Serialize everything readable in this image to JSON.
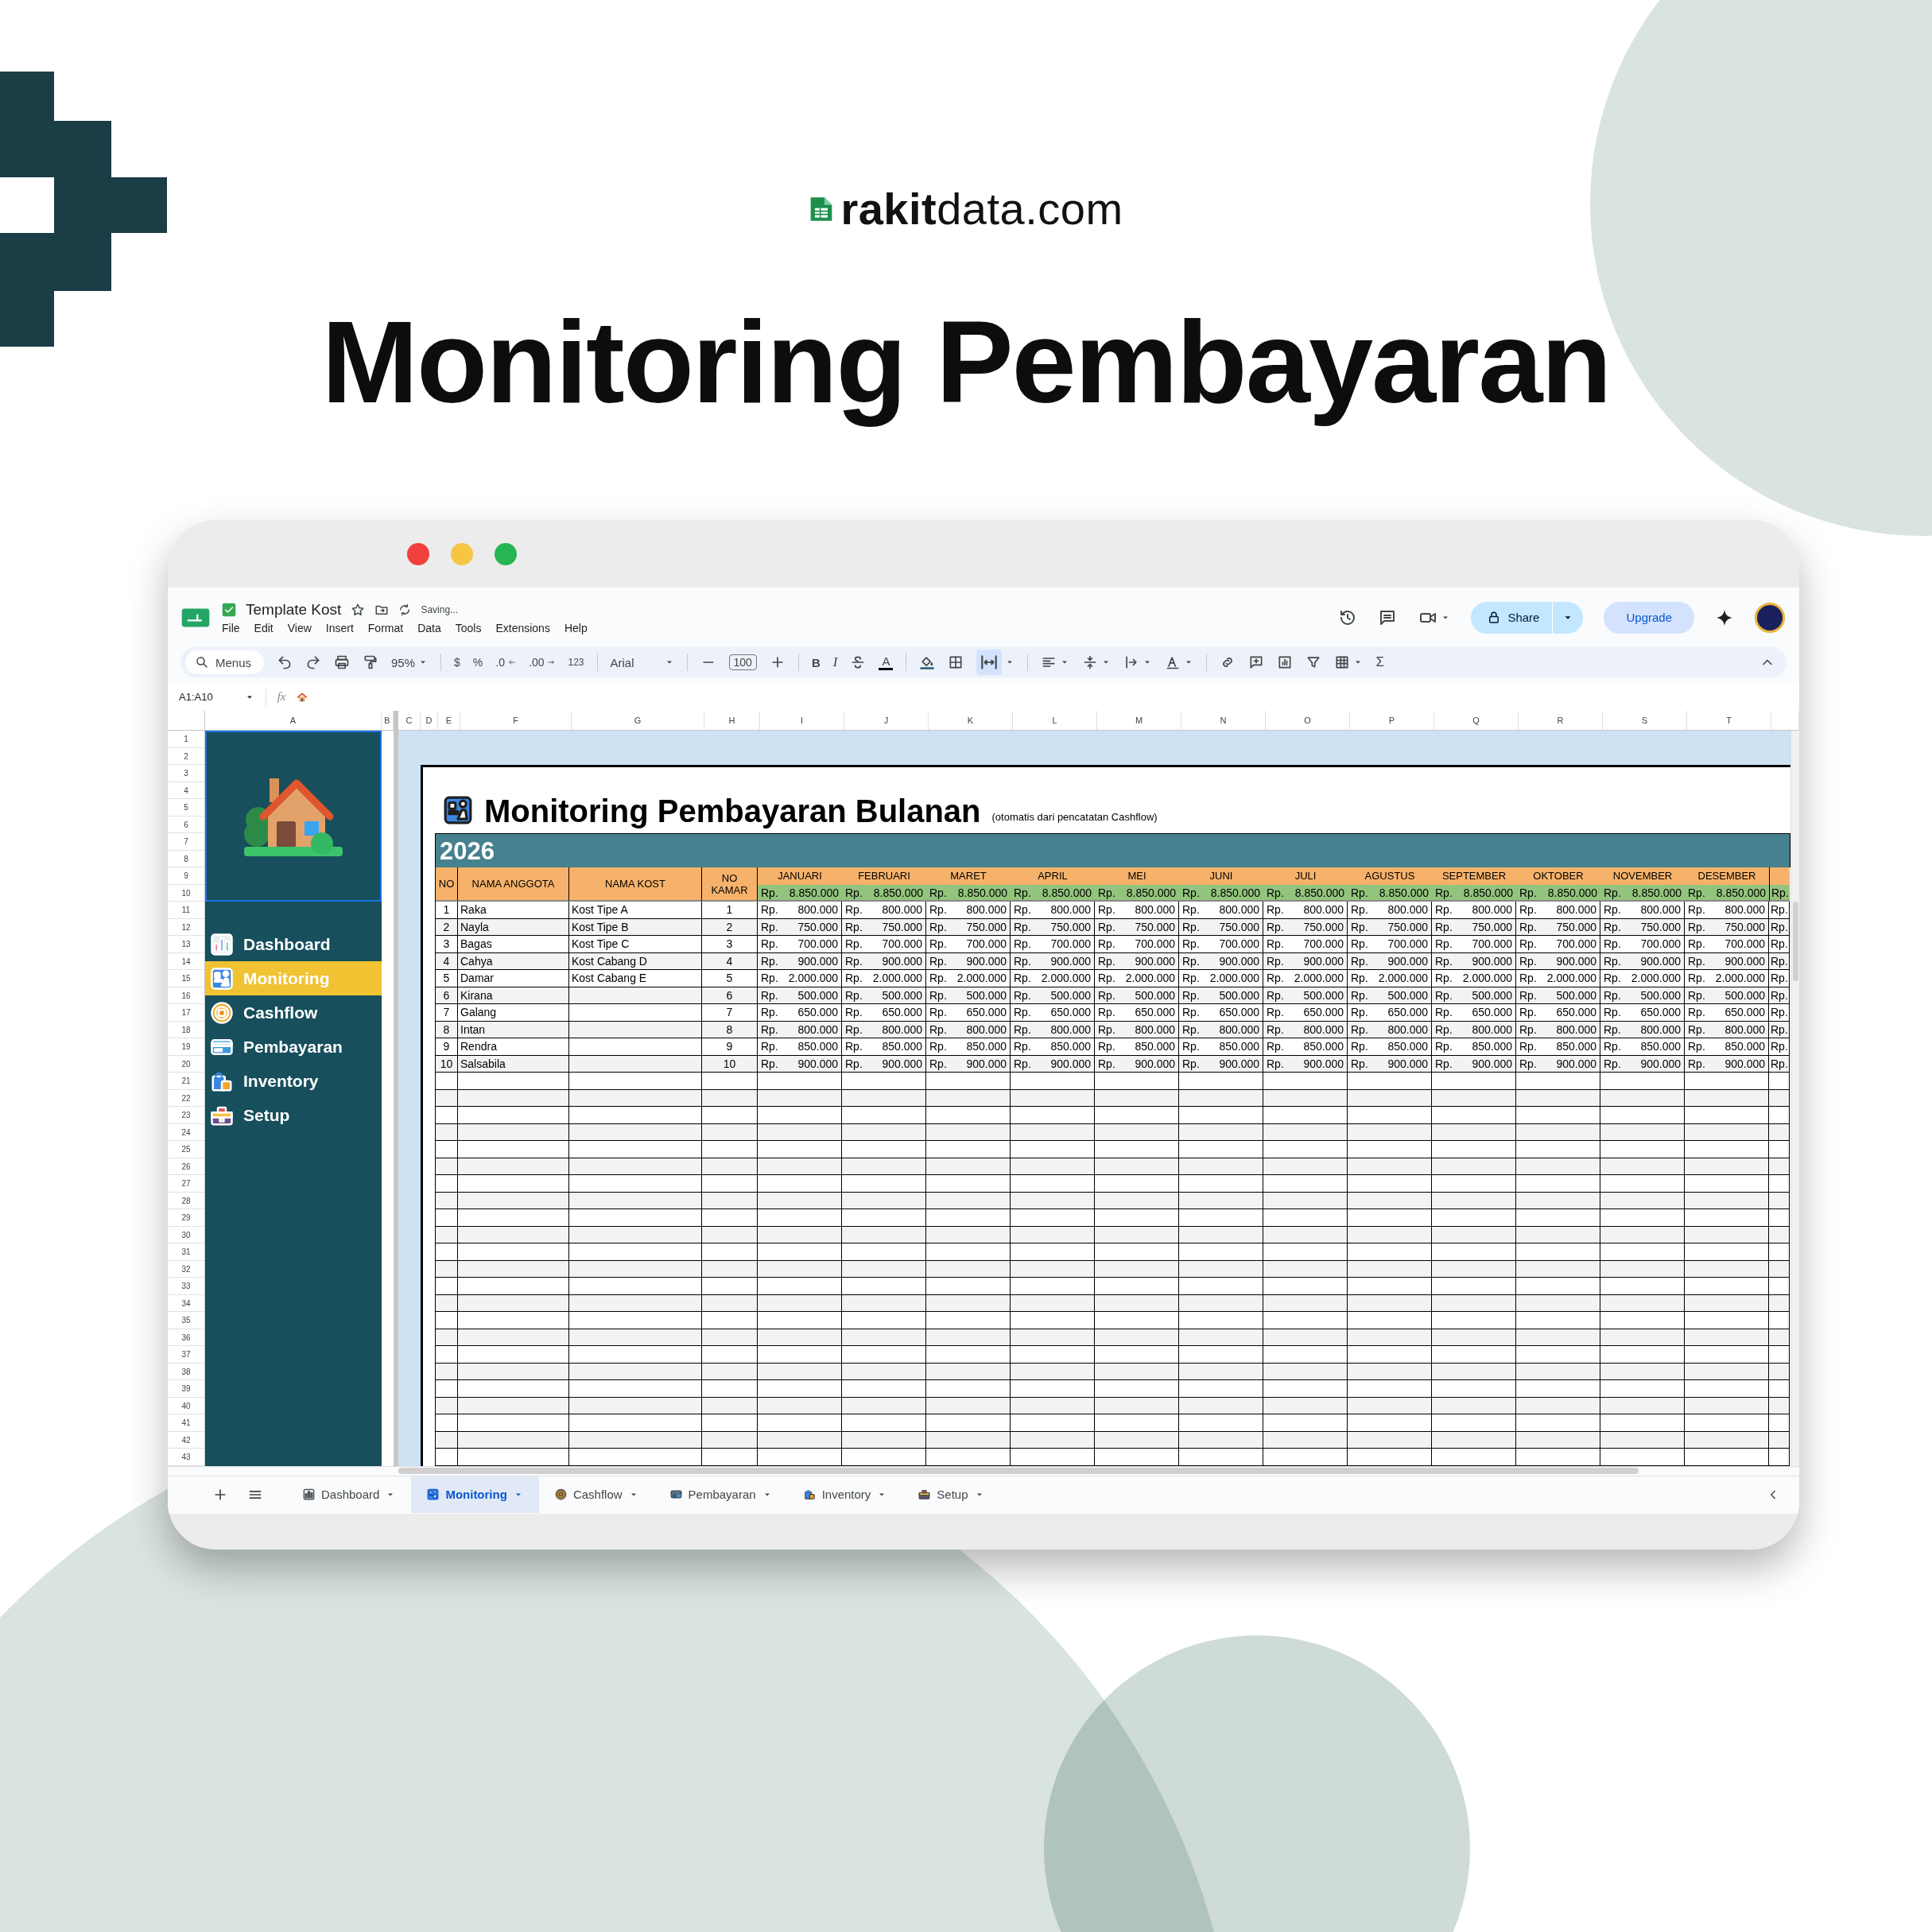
{
  "brand": "**rakit**data.com",
  "headline": "Monitoring Pembayaran",
  "sheets_header": {
    "doc_title": "Template Kost",
    "status": "Saving...",
    "menus": [
      "File",
      "Edit",
      "View",
      "Insert",
      "Format",
      "Data",
      "Tools",
      "Extensions",
      "Help"
    ],
    "share": "Share",
    "upgrade": "Upgrade"
  },
  "toolbar": {
    "search": "Menus",
    "zoom": "95%",
    "currency": "$",
    "percent": "%",
    "decrease_decimals": ".0",
    "increase_decimals": ".00",
    "number_format": "123",
    "font": "Arial",
    "font_size": "100",
    "bold": "B",
    "italic": "I",
    "text_color": "A",
    "merge_selected": true,
    "sum": "Σ"
  },
  "formula_bar": {
    "name_box": "A1:A10",
    "fx": "fx"
  },
  "columns": [
    "A",
    "B",
    "C",
    "D",
    "E",
    "F",
    "G",
    "H",
    "I",
    "J",
    "K",
    "L",
    "M",
    "N",
    "O",
    "P",
    "Q",
    "R",
    "S",
    "T"
  ],
  "rows": [
    "1",
    "2",
    "3",
    "4",
    "5",
    "6",
    "7",
    "8",
    "9",
    "10",
    "11",
    "12",
    "13",
    "14",
    "15",
    "16",
    "17",
    "18",
    "19",
    "20",
    "21",
    "22",
    "23",
    "24",
    "25",
    "26",
    "27",
    "28",
    "29",
    "30",
    "31",
    "32",
    "33",
    "34",
    "35",
    "36",
    "37",
    "38",
    "39",
    "40",
    "41",
    "42",
    "43"
  ],
  "sidebar": {
    "items": [
      {
        "label": "Dashboard",
        "selected": false
      },
      {
        "label": "Monitoring",
        "selected": true
      },
      {
        "label": "Cashflow",
        "selected": false
      },
      {
        "label": "Pembayaran",
        "selected": false
      },
      {
        "label": "Inventory",
        "selected": false
      },
      {
        "label": "Setup",
        "selected": false
      }
    ]
  },
  "sheet": {
    "title": "Monitoring Pembayaran Bulanan",
    "note": "(otomatis dari pencatatan Cashflow)",
    "year": "2026",
    "headers": {
      "no": "NO",
      "name": "NAMA ANGGOTA",
      "kost": "NAMA KOST",
      "room": "NO KAMAR"
    },
    "months": [
      {
        "name": "JANUARI",
        "currency": "Rp.",
        "total": "8.850.000"
      },
      {
        "name": "FEBRUARI",
        "currency": "Rp.",
        "total": "8.850.000"
      },
      {
        "name": "MARET",
        "currency": "Rp.",
        "total": "8.850.000"
      },
      {
        "name": "APRIL",
        "currency": "Rp.",
        "total": "8.850.000"
      },
      {
        "name": "MEI",
        "currency": "Rp.",
        "total": "8.850.000"
      },
      {
        "name": "JUNI",
        "currency": "Rp.",
        "total": "8.850.000"
      },
      {
        "name": "JULI",
        "currency": "Rp.",
        "total": "8.850.000"
      },
      {
        "name": "AGUSTUS",
        "currency": "Rp.",
        "total": "8.850.000"
      },
      {
        "name": "SEPTEMBER",
        "currency": "Rp.",
        "total": "8.850.000"
      },
      {
        "name": "OKTOBER",
        "currency": "Rp.",
        "total": "8.850.000"
      },
      {
        "name": "NOVEMBER",
        "currency": "Rp.",
        "total": "8.850.000"
      },
      {
        "name": "DESEMBER",
        "currency": "Rp.",
        "total": "8.850.000"
      }
    ],
    "extra_column": {
      "currency": "Rp."
    },
    "rows": [
      {
        "no": "1",
        "name": "Raka",
        "kost": "Kost Tipe A",
        "room": "1",
        "payments": [
          [
            "Rp.",
            "800.000"
          ],
          [
            "Rp.",
            "800.000"
          ],
          [
            "Rp.",
            "800.000"
          ],
          [
            "Rp.",
            "800.000"
          ],
          [
            "Rp.",
            "800.000"
          ],
          [
            "Rp.",
            "800.000"
          ],
          [
            "Rp.",
            "800.000"
          ],
          [
            "Rp.",
            "800.000"
          ],
          [
            "Rp.",
            "800.000"
          ],
          [
            "Rp.",
            "800.000"
          ],
          [
            "Rp.",
            "800.000"
          ],
          [
            "Rp.",
            "800.000"
          ]
        ],
        "extra": "Rp."
      },
      {
        "no": "2",
        "name": "Nayla",
        "kost": "Kost Tipe B",
        "room": "2",
        "payments": [
          [
            "Rp.",
            "750.000"
          ],
          [
            "Rp.",
            "750.000"
          ],
          [
            "Rp.",
            "750.000"
          ],
          [
            "Rp.",
            "750.000"
          ],
          [
            "Rp.",
            "750.000"
          ],
          [
            "Rp.",
            "750.000"
          ],
          [
            "Rp.",
            "750.000"
          ],
          [
            "Rp.",
            "750.000"
          ],
          [
            "Rp.",
            "750.000"
          ],
          [
            "Rp.",
            "750.000"
          ],
          [
            "Rp.",
            "750.000"
          ],
          [
            "Rp.",
            "750.000"
          ]
        ],
        "extra": "Rp."
      },
      {
        "no": "3",
        "name": "Bagas",
        "kost": "Kost Tipe C",
        "room": "3",
        "payments": [
          [
            "Rp.",
            "700.000"
          ],
          [
            "Rp.",
            "700.000"
          ],
          [
            "Rp.",
            "700.000"
          ],
          [
            "Rp.",
            "700.000"
          ],
          [
            "Rp.",
            "700.000"
          ],
          [
            "Rp.",
            "700.000"
          ],
          [
            "Rp.",
            "700.000"
          ],
          [
            "Rp.",
            "700.000"
          ],
          [
            "Rp.",
            "700.000"
          ],
          [
            "Rp.",
            "700.000"
          ],
          [
            "Rp.",
            "700.000"
          ],
          [
            "Rp.",
            "700.000"
          ]
        ],
        "extra": "Rp."
      },
      {
        "no": "4",
        "name": "Cahya",
        "kost": "Kost Cabang D",
        "room": "4",
        "payments": [
          [
            "Rp.",
            "900.000"
          ],
          [
            "Rp.",
            "900.000"
          ],
          [
            "Rp.",
            "900.000"
          ],
          [
            "Rp.",
            "900.000"
          ],
          [
            "Rp.",
            "900.000"
          ],
          [
            "Rp.",
            "900.000"
          ],
          [
            "Rp.",
            "900.000"
          ],
          [
            "Rp.",
            "900.000"
          ],
          [
            "Rp.",
            "900.000"
          ],
          [
            "Rp.",
            "900.000"
          ],
          [
            "Rp.",
            "900.000"
          ],
          [
            "Rp.",
            "900.000"
          ]
        ],
        "extra": "Rp."
      },
      {
        "no": "5",
        "name": "Damar",
        "kost": "Kost Cabang E",
        "room": "5",
        "payments": [
          [
            "Rp.",
            "2.000.000"
          ],
          [
            "Rp.",
            "2.000.000"
          ],
          [
            "Rp.",
            "2.000.000"
          ],
          [
            "Rp.",
            "2.000.000"
          ],
          [
            "Rp.",
            "2.000.000"
          ],
          [
            "Rp.",
            "2.000.000"
          ],
          [
            "Rp.",
            "2.000.000"
          ],
          [
            "Rp.",
            "2.000.000"
          ],
          [
            "Rp.",
            "2.000.000"
          ],
          [
            "Rp.",
            "2.000.000"
          ],
          [
            "Rp.",
            "2.000.000"
          ],
          [
            "Rp.",
            "2.000.000"
          ]
        ],
        "extra": "Rp."
      },
      {
        "no": "6",
        "name": "Kirana",
        "room": "6",
        "payments": [
          [
            "Rp.",
            "500.000"
          ],
          [
            "Rp.",
            "500.000"
          ],
          [
            "Rp.",
            "500.000"
          ],
          [
            "Rp.",
            "500.000"
          ],
          [
            "Rp.",
            "500.000"
          ],
          [
            "Rp.",
            "500.000"
          ],
          [
            "Rp.",
            "500.000"
          ],
          [
            "Rp.",
            "500.000"
          ],
          [
            "Rp.",
            "500.000"
          ],
          [
            "Rp.",
            "500.000"
          ],
          [
            "Rp.",
            "500.000"
          ],
          [
            "Rp.",
            "500.000"
          ]
        ],
        "extra": "Rp."
      },
      {
        "no": "7",
        "name": "Galang",
        "room": "7",
        "payments": [
          [
            "Rp.",
            "650.000"
          ],
          [
            "Rp.",
            "650.000"
          ],
          [
            "Rp.",
            "650.000"
          ],
          [
            "Rp.",
            "650.000"
          ],
          [
            "Rp.",
            "650.000"
          ],
          [
            "Rp.",
            "650.000"
          ],
          [
            "Rp.",
            "650.000"
          ],
          [
            "Rp.",
            "650.000"
          ],
          [
            "Rp.",
            "650.000"
          ],
          [
            "Rp.",
            "650.000"
          ],
          [
            "Rp.",
            "650.000"
          ],
          [
            "Rp.",
            "650.000"
          ]
        ],
        "extra": "Rp."
      },
      {
        "no": "8",
        "name": "Intan",
        "room": "8",
        "payments": [
          [
            "Rp.",
            "800.000"
          ],
          [
            "Rp.",
            "800.000"
          ],
          [
            "Rp.",
            "800.000"
          ],
          [
            "Rp.",
            "800.000"
          ],
          [
            "Rp.",
            "800.000"
          ],
          [
            "Rp.",
            "800.000"
          ],
          [
            "Rp.",
            "800.000"
          ],
          [
            "Rp.",
            "800.000"
          ],
          [
            "Rp.",
            "800.000"
          ],
          [
            "Rp.",
            "800.000"
          ],
          [
            "Rp.",
            "800.000"
          ],
          [
            "Rp.",
            "800.000"
          ]
        ],
        "extra": "Rp."
      },
      {
        "no": "9",
        "name": "Rendra",
        "room": "9",
        "payments": [
          [
            "Rp.",
            "850.000"
          ],
          [
            "Rp.",
            "850.000"
          ],
          [
            "Rp.",
            "850.000"
          ],
          [
            "Rp.",
            "850.000"
          ],
          [
            "Rp.",
            "850.000"
          ],
          [
            "Rp.",
            "850.000"
          ],
          [
            "Rp.",
            "850.000"
          ],
          [
            "Rp.",
            "850.000"
          ],
          [
            "Rp.",
            "850.000"
          ],
          [
            "Rp.",
            "850.000"
          ],
          [
            "Rp.",
            "850.000"
          ],
          [
            "Rp.",
            "850.000"
          ]
        ],
        "extra": "Rp."
      },
      {
        "no": "10",
        "name": "Salsabila",
        "room": "10",
        "payments": [
          [
            "Rp.",
            "900.000"
          ],
          [
            "Rp.",
            "900.000"
          ],
          [
            "Rp.",
            "900.000"
          ],
          [
            "Rp.",
            "900.000"
          ],
          [
            "Rp.",
            "900.000"
          ],
          [
            "Rp.",
            "900.000"
          ],
          [
            "Rp.",
            "900.000"
          ],
          [
            "Rp.",
            "900.000"
          ],
          [
            "Rp.",
            "900.000"
          ],
          [
            "Rp.",
            "900.000"
          ],
          [
            "Rp.",
            "900.000"
          ],
          [
            "Rp.",
            "900.000"
          ]
        ],
        "extra": "Rp."
      }
    ]
  },
  "sheet_tabs": [
    {
      "label": "Dashboard",
      "selected": false
    },
    {
      "label": "Monitoring",
      "selected": true
    },
    {
      "label": "Cashflow",
      "selected": false
    },
    {
      "label": "Pembayaran",
      "selected": false
    },
    {
      "label": "Inventory",
      "selected": false
    },
    {
      "label": "Setup",
      "selected": false
    }
  ]
}
